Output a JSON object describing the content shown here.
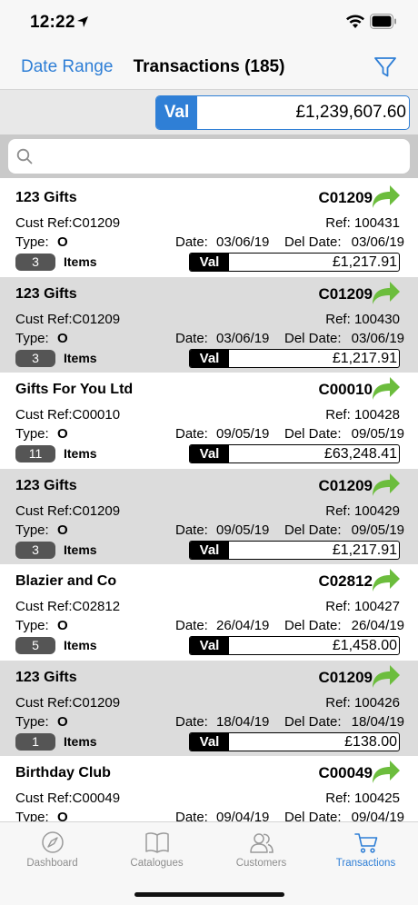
{
  "status": {
    "time": "12:22"
  },
  "nav": {
    "left": "Date Range",
    "title": "Transactions (185)"
  },
  "total": {
    "label": "Val",
    "value": "£1,239,607.60"
  },
  "search": {
    "placeholder": ""
  },
  "labels": {
    "cust_ref": "Cust Ref:",
    "ref": "Ref:",
    "type": "Type:",
    "date": "Date:",
    "del_date": "Del Date:",
    "items": "Items",
    "val": "Val"
  },
  "transactions": [
    {
      "name": "123 Gifts",
      "account": "C01209",
      "cust_ref": "C01209",
      "ref": "100431",
      "type": "O",
      "date": "03/06/19",
      "del_date": "03/06/19",
      "items": "3",
      "value": "£1,217.91"
    },
    {
      "name": "123 Gifts",
      "account": "C01209",
      "cust_ref": "C01209",
      "ref": "100430",
      "type": "O",
      "date": "03/06/19",
      "del_date": "03/06/19",
      "items": "3",
      "value": "£1,217.91"
    },
    {
      "name": "Gifts For You Ltd",
      "account": "C00010",
      "cust_ref": "C00010",
      "ref": "100428",
      "type": "O",
      "date": "09/05/19",
      "del_date": "09/05/19",
      "items": "11",
      "value": "£63,248.41"
    },
    {
      "name": "123 Gifts",
      "account": "C01209",
      "cust_ref": "C01209",
      "ref": "100429",
      "type": "O",
      "date": "09/05/19",
      "del_date": "09/05/19",
      "items": "3",
      "value": "£1,217.91"
    },
    {
      "name": "Blazier and Co",
      "account": "C02812",
      "cust_ref": "C02812",
      "ref": "100427",
      "type": "O",
      "date": "26/04/19",
      "del_date": "26/04/19",
      "items": "5",
      "value": "£1,458.00"
    },
    {
      "name": "123 Gifts",
      "account": "C01209",
      "cust_ref": "C01209",
      "ref": "100426",
      "type": "O",
      "date": "18/04/19",
      "del_date": "18/04/19",
      "items": "1",
      "value": "£138.00"
    },
    {
      "name": "Birthday Club",
      "account": "C00049",
      "cust_ref": "C00049",
      "ref": "100425",
      "type": "O",
      "date": "09/04/19",
      "del_date": "09/04/19",
      "items": "",
      "value": ""
    }
  ],
  "tabs": [
    {
      "label": "Dashboard",
      "icon": "compass-icon",
      "active": false
    },
    {
      "label": "Catalogues",
      "icon": "book-icon",
      "active": false
    },
    {
      "label": "Customers",
      "icon": "people-icon",
      "active": false
    },
    {
      "label": "Transactions",
      "icon": "cart-icon",
      "active": true
    }
  ],
  "colors": {
    "accent": "#2f7fd6",
    "arrow_green": "#6cbd3d",
    "alt_row": "#dcdcdc"
  }
}
